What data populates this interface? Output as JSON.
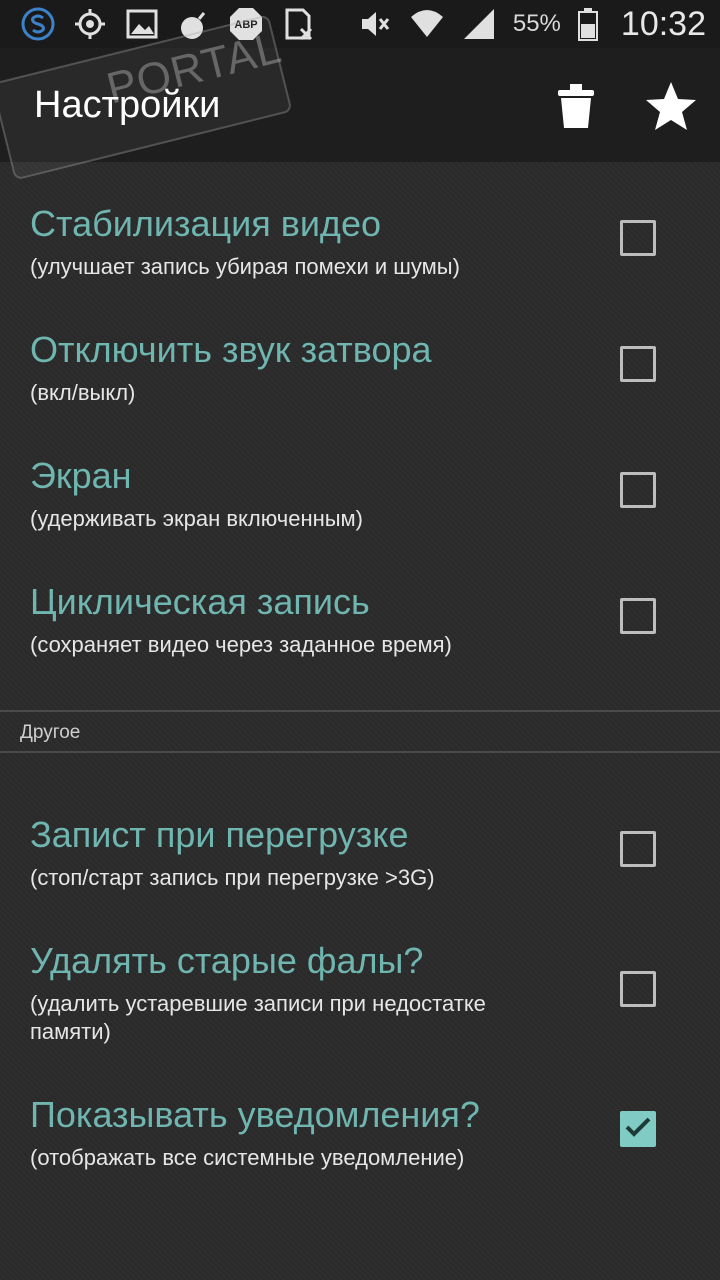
{
  "status_bar": {
    "battery": "55%",
    "time": "10:32",
    "icons_left": [
      "s-logo-icon",
      "gps-icon",
      "image-icon",
      "bomb-icon",
      "abp-icon",
      "sim-icon"
    ],
    "icons_right": [
      "mute-icon",
      "wifi-icon",
      "signal-icon",
      "battery-icon"
    ]
  },
  "watermark": {
    "text": "PORTAL"
  },
  "action_bar": {
    "title": "Настройки",
    "actions": [
      "trash-icon",
      "star-icon"
    ]
  },
  "settings": [
    {
      "title": "Стабилизация видео",
      "summary": "(улучшает запись убирая помехи и шумы)",
      "checked": false
    },
    {
      "title": "Отключить звук затвора",
      "summary": "(вкл/выкл)",
      "checked": false
    },
    {
      "title": "Экран",
      "summary": "(удерживать экран включенным)",
      "checked": false
    },
    {
      "title": "Циклическая запись",
      "summary": "(сохраняет видео через заданное время)",
      "checked": false
    }
  ],
  "section": {
    "title": "Другое"
  },
  "other_settings": [
    {
      "title": "Запист при перегрузке",
      "summary": "(стоп/старт запись при перегрузке >3G)",
      "checked": false
    },
    {
      "title": "Удалять старые фалы?",
      "summary": "(удалить устаревшие записи при недостатке памяти)",
      "checked": false
    },
    {
      "title": "Показывать уведомления?",
      "summary": "(отображать все системные уведомление)",
      "checked": true
    }
  ],
  "colors": {
    "accent": "#6fb5b0",
    "checkbox_checked": "#80cbc4",
    "background": "#2b2b2b"
  }
}
